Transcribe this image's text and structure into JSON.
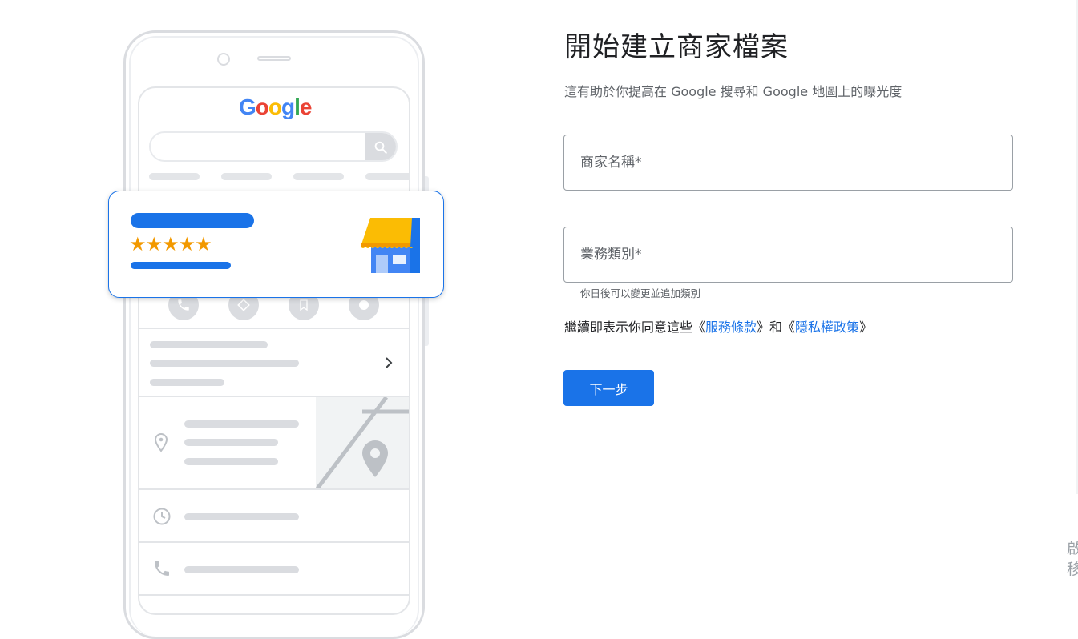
{
  "illustration": {
    "logo_letters": [
      {
        "ch": "G",
        "color": "#4285F4"
      },
      {
        "ch": "o",
        "color": "#EA4335"
      },
      {
        "ch": "o",
        "color": "#FBBC05"
      },
      {
        "ch": "g",
        "color": "#4285F4"
      },
      {
        "ch": "l",
        "color": "#34A853"
      },
      {
        "ch": "e",
        "color": "#EA4335"
      }
    ],
    "rating_stars": "★★★★★"
  },
  "form": {
    "title": "開始建立商家檔案",
    "subtitle": "這有助於你提高在 Google 搜尋和 Google 地圖上的曝光度",
    "business_name_placeholder": "商家名稱*",
    "category_placeholder": "業務類別*",
    "category_hint": "你日後可以變更並追加類別",
    "terms_prefix": "繼續即表示你同意這些《",
    "terms_link": "服務條款",
    "terms_middle": "》和《",
    "privacy_link": "隱私權政策",
    "terms_suffix": "》",
    "next_label": "下一步"
  },
  "edge": {
    "line1": "啟",
    "line2": "移"
  },
  "colors": {
    "accent": "#1a73e8",
    "star": "#f29900"
  }
}
